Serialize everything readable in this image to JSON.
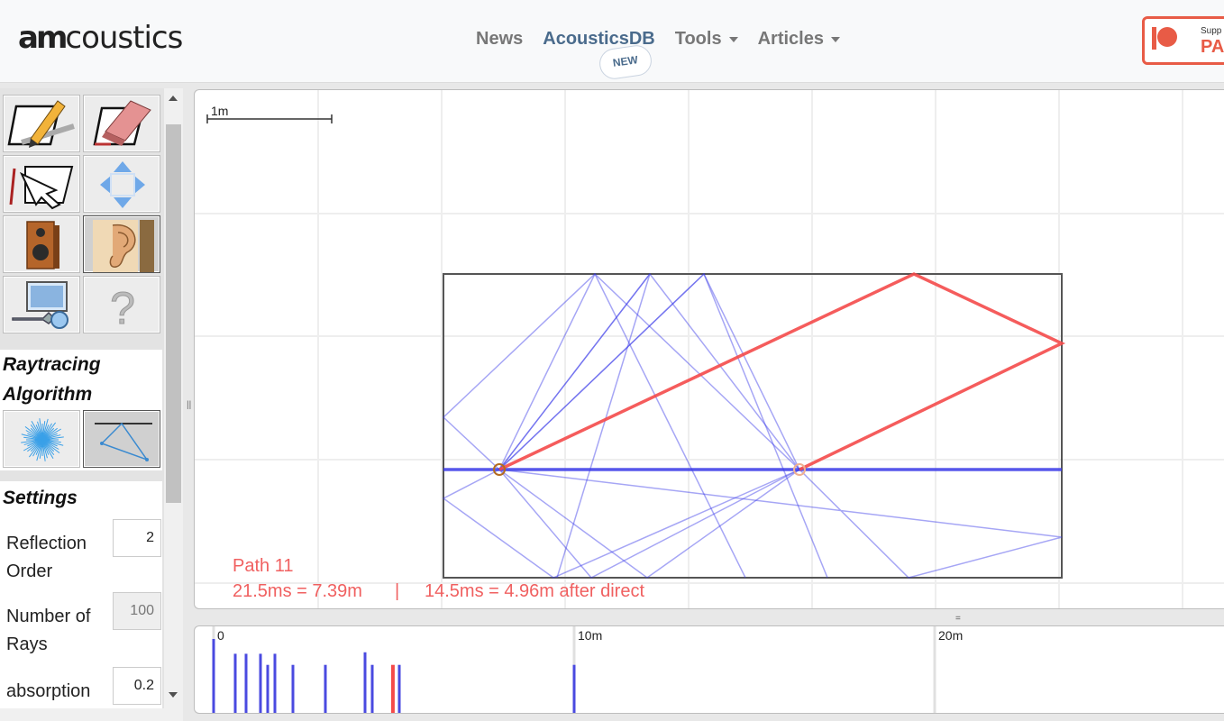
{
  "header": {
    "logo_prefix": "am",
    "logo_suffix": "coustics",
    "nav": {
      "news": "News",
      "acousticsdb": "AcousticsDB",
      "tools": "Tools",
      "articles": "Articles"
    },
    "new_badge": "NEW",
    "patreon": {
      "line1": "Supp",
      "line2": "PA"
    }
  },
  "sidebar": {
    "tools": [
      {
        "name": "draw-wall",
        "icon": "pencil-icon"
      },
      {
        "name": "erase-wall",
        "icon": "eraser-icon"
      },
      {
        "name": "select",
        "icon": "select-arrow-icon"
      },
      {
        "name": "move",
        "icon": "move-arrows-icon"
      },
      {
        "name": "place-source",
        "icon": "speaker-icon"
      },
      {
        "name": "place-listener",
        "icon": "ear-icon"
      },
      {
        "name": "settings",
        "icon": "wrench-monitor-icon"
      },
      {
        "name": "help",
        "icon": "question-icon"
      }
    ],
    "algorithm_title_line1": "Raytracing",
    "algorithm_title_line2": "Algorithm",
    "algorithms": [
      {
        "name": "stochastic",
        "icon": "ray-burst-icon"
      },
      {
        "name": "image-source",
        "icon": "image-source-icon"
      }
    ],
    "settings_title": "Settings",
    "settings": {
      "reflection_order": {
        "label1": "Reflection",
        "label2": "Order",
        "value": "2"
      },
      "number_of_rays": {
        "label1": "Number of",
        "label2": "Rays",
        "value": "100"
      },
      "absorption": {
        "label": "absorption",
        "value": "0.2"
      }
    }
  },
  "canvas": {
    "scale_label": "1m",
    "path_title": "Path 11",
    "path_time": "21.5ms = 7.39m",
    "separator": "|",
    "path_delta": "14.5ms = 4.96m after direct",
    "colors": {
      "highlight": "#f44a4a",
      "rays": "#3a3ae8",
      "room": "#555555"
    }
  },
  "echogram": {
    "tick_labels": [
      "0",
      "10m",
      "20m"
    ],
    "tick_meters": [
      0,
      10,
      20
    ],
    "arrivals_m": [
      0.0,
      0.6,
      0.9,
      1.3,
      1.5,
      1.7,
      2.2,
      3.1,
      4.2,
      4.4,
      4.96,
      5.15,
      10.0
    ],
    "highlight_index": 10,
    "bar_heights_rel": [
      1.0,
      0.8,
      0.8,
      0.8,
      0.65,
      0.8,
      0.65,
      0.65,
      0.82,
      0.65,
      0.65,
      0.65,
      0.65
    ]
  }
}
